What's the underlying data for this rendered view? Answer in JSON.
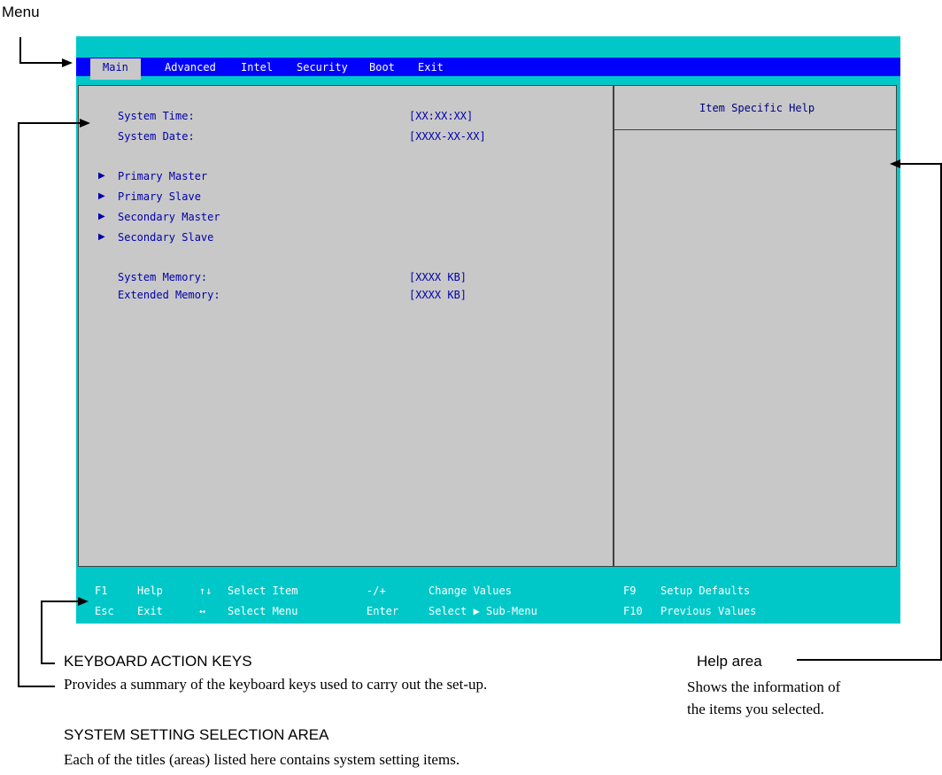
{
  "annotations": {
    "menu": "Menu",
    "keyboard_title": "KEYBOARD ACTION KEYS",
    "keyboard_desc": "Provides a summary of the keyboard keys used to carry out the set-up.",
    "system_title": "SYSTEM SETTING SELECTION AREA",
    "system_desc": "Each of the titles (areas) listed here contains system setting items.",
    "help_title": "Help area",
    "help_desc_1": "Shows the information of",
    "help_desc_2": "the items you selected."
  },
  "menu": {
    "items": [
      "Main",
      "Advanced",
      "Intel",
      "Security",
      "Boot",
      "Exit"
    ]
  },
  "settings": {
    "system_time_label": "System Time:",
    "system_time_value": "[XX:XX:XX]",
    "system_date_label": "System Date:",
    "system_date_value": "[XXXX-XX-XX]",
    "submenus": [
      "Primary Master",
      "Primary Slave",
      "Secondary Master",
      "Secondary Slave"
    ],
    "system_memory_label": "System Memory:",
    "system_memory_value": "[XXXX KB]",
    "extended_memory_label": "Extended Memory:",
    "extended_memory_value": "[XXXX KB]"
  },
  "help": {
    "title": "Item Specific Help"
  },
  "keys": {
    "row1": [
      "F1",
      "Help",
      "↑↓",
      "Select Item",
      "-/+",
      "Change Values",
      "F9",
      "Setup Defaults"
    ],
    "row2": [
      "Esc",
      "Exit",
      "↔",
      "Select Menu",
      "Enter",
      "Select ▶ Sub-Menu",
      "F10",
      "Previous Values"
    ]
  },
  "colors": {
    "screen_bg": "#00c8c8",
    "menu_bar": "#0000ff",
    "panel_bg": "#c8c8c8",
    "text_blue": "#0000aa"
  }
}
